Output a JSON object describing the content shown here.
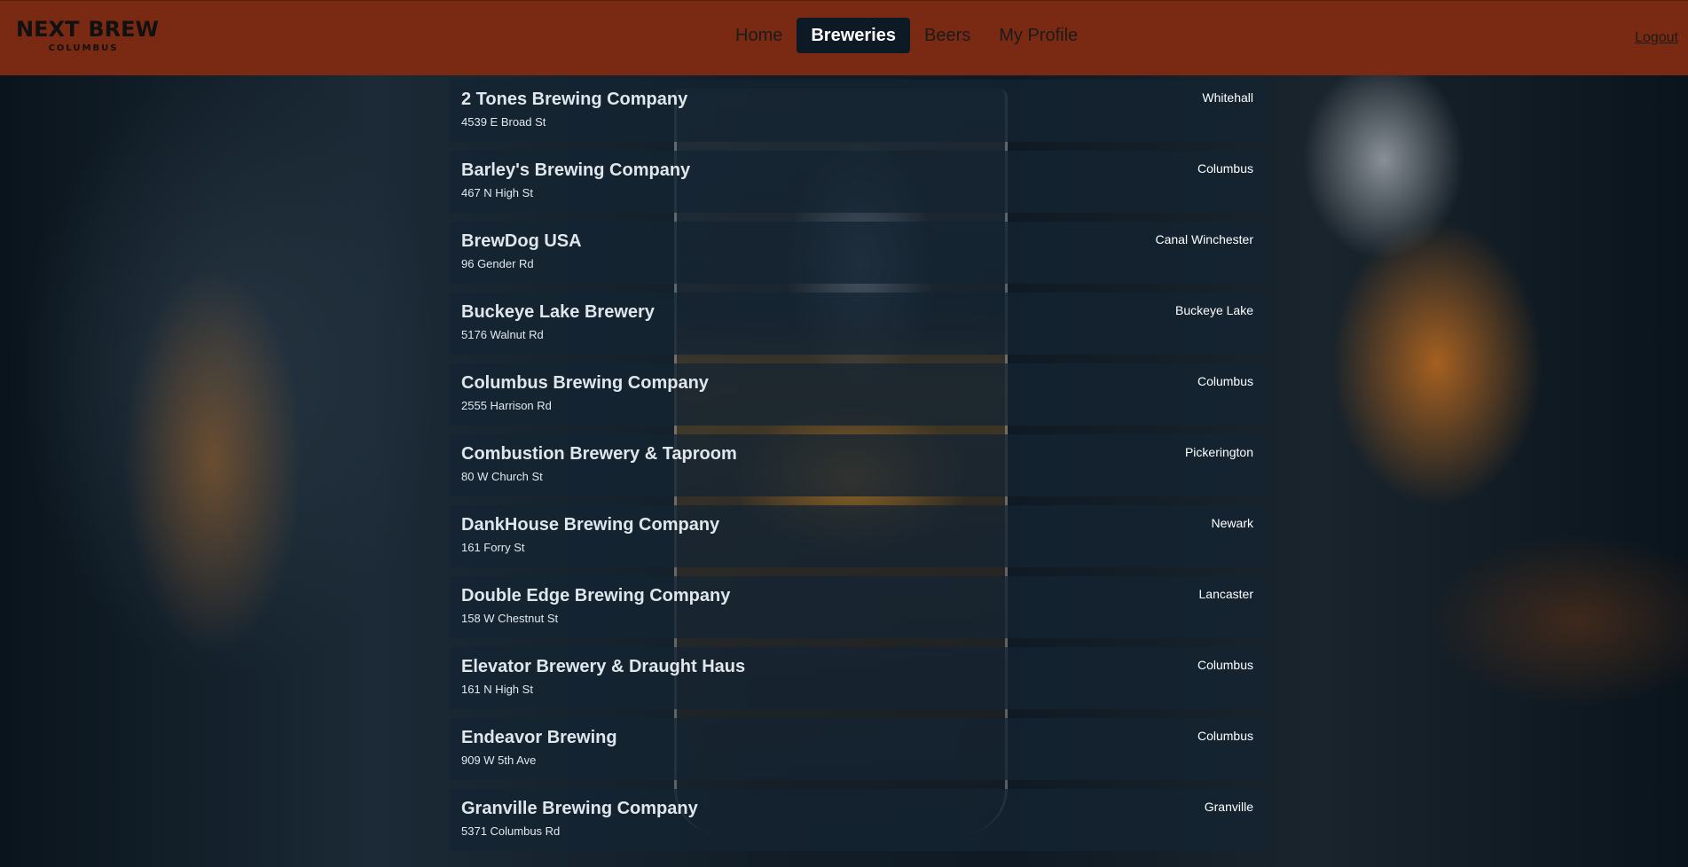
{
  "brand": {
    "name_left": "NEXT",
    "name_right": "BREW",
    "subtitle": "COLUMBUS"
  },
  "nav": {
    "links": [
      {
        "label": "Home"
      },
      {
        "label": "Breweries"
      },
      {
        "label": "Beers"
      },
      {
        "label": "My Profile"
      }
    ],
    "active": "Breweries",
    "logout_label": "Logout"
  },
  "colors": {
    "navbar": "#7a2a12",
    "active_pill": "#0d1a26",
    "card_bg": "#142432"
  },
  "breweries": [
    {
      "name": "2 Tones Brewing Company",
      "address": "4539 E Broad St",
      "city": "Whitehall"
    },
    {
      "name": "Barley's Brewing Company",
      "address": "467 N High St",
      "city": "Columbus"
    },
    {
      "name": "BrewDog USA",
      "address": "96 Gender Rd",
      "city": "Canal Winchester"
    },
    {
      "name": "Buckeye Lake Brewery",
      "address": "5176 Walnut Rd",
      "city": "Buckeye Lake"
    },
    {
      "name": "Columbus Brewing Company",
      "address": "2555 Harrison Rd",
      "city": "Columbus"
    },
    {
      "name": "Combustion Brewery & Taproom",
      "address": "80 W Church St",
      "city": "Pickerington"
    },
    {
      "name": "DankHouse Brewing Company",
      "address": "161 Forry St",
      "city": "Newark"
    },
    {
      "name": "Double Edge Brewing Company",
      "address": "158 W Chestnut St",
      "city": "Lancaster"
    },
    {
      "name": "Elevator Brewery & Draught Haus",
      "address": "161 N High St",
      "city": "Columbus"
    },
    {
      "name": "Endeavor Brewing",
      "address": "909 W 5th Ave",
      "city": "Columbus"
    },
    {
      "name": "Granville Brewing Company",
      "address": "5371 Columbus Rd",
      "city": "Granville"
    }
  ]
}
